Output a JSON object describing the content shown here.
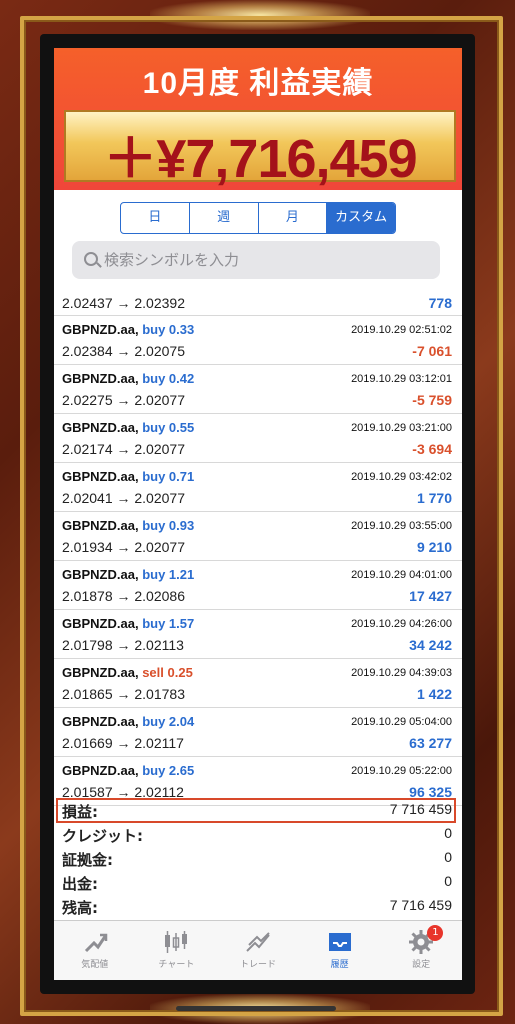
{
  "banner": {
    "title": "10月度 利益実績",
    "amount": "＋¥7,716,459"
  },
  "period_tabs": [
    "日",
    "週",
    "月",
    "カスタム"
  ],
  "period_active": "カスタム",
  "search": {
    "placeholder": "検索シンボルを入力"
  },
  "trades_partial": {
    "prices": "2.02437 → 2.02392",
    "profit": "778"
  },
  "trades": [
    {
      "symbol": "GBPNZD.aa,",
      "side": "buy",
      "lot": "buy 0.33",
      "time": "2019.10.29 02:51:02",
      "prices": "2.02384 → 2.02075",
      "profit": "-7 061"
    },
    {
      "symbol": "GBPNZD.aa,",
      "side": "buy",
      "lot": "buy 0.42",
      "time": "2019.10.29 03:12:01",
      "prices": "2.02275 → 2.02077",
      "profit": "-5 759"
    },
    {
      "symbol": "GBPNZD.aa,",
      "side": "buy",
      "lot": "buy 0.55",
      "time": "2019.10.29 03:21:00",
      "prices": "2.02174 → 2.02077",
      "profit": "-3 694"
    },
    {
      "symbol": "GBPNZD.aa,",
      "side": "buy",
      "lot": "buy 0.71",
      "time": "2019.10.29 03:42:02",
      "prices": "2.02041 → 2.02077",
      "profit": "1 770"
    },
    {
      "symbol": "GBPNZD.aa,",
      "side": "buy",
      "lot": "buy 0.93",
      "time": "2019.10.29 03:55:00",
      "prices": "2.01934 → 2.02077",
      "profit": "9 210"
    },
    {
      "symbol": "GBPNZD.aa,",
      "side": "buy",
      "lot": "buy 1.21",
      "time": "2019.10.29 04:01:00",
      "prices": "2.01878 → 2.02086",
      "profit": "17 427"
    },
    {
      "symbol": "GBPNZD.aa,",
      "side": "buy",
      "lot": "buy 1.57",
      "time": "2019.10.29 04:26:00",
      "prices": "2.01798 → 2.02113",
      "profit": "34 242"
    },
    {
      "symbol": "GBPNZD.aa,",
      "side": "sell",
      "lot": "sell 0.25",
      "time": "2019.10.29 04:39:03",
      "prices": "2.01865 → 2.01783",
      "profit": "1 422"
    },
    {
      "symbol": "GBPNZD.aa,",
      "side": "buy",
      "lot": "buy 2.04",
      "time": "2019.10.29 05:04:00",
      "prices": "2.01669 → 2.02117",
      "profit": "63 277"
    },
    {
      "symbol": "GBPNZD.aa,",
      "side": "buy",
      "lot": "buy 2.65",
      "time": "2019.10.29 05:22:00",
      "prices": "2.01587 → 2.02112",
      "profit": "96 325"
    }
  ],
  "summary": [
    {
      "label": "損益:",
      "value": "7 716 459",
      "highlight": true
    },
    {
      "label": "クレジット:",
      "value": "0"
    },
    {
      "label": "証拠金:",
      "value": "0"
    },
    {
      "label": "出金:",
      "value": "0"
    },
    {
      "label": "残高:",
      "value": "7 716 459"
    }
  ],
  "tabbar": [
    {
      "label": "気配値",
      "icon": "quotes-icon"
    },
    {
      "label": "チャート",
      "icon": "chart-icon"
    },
    {
      "label": "トレード",
      "icon": "trade-icon"
    },
    {
      "label": "履歴",
      "icon": "history-icon",
      "active": true
    },
    {
      "label": "設定",
      "icon": "settings-icon",
      "badge": "1"
    }
  ],
  "colors": {
    "accent": "#2a6ccf",
    "loss": "#d9502c",
    "banner": "#f0463a",
    "gold": "#d4a445"
  }
}
